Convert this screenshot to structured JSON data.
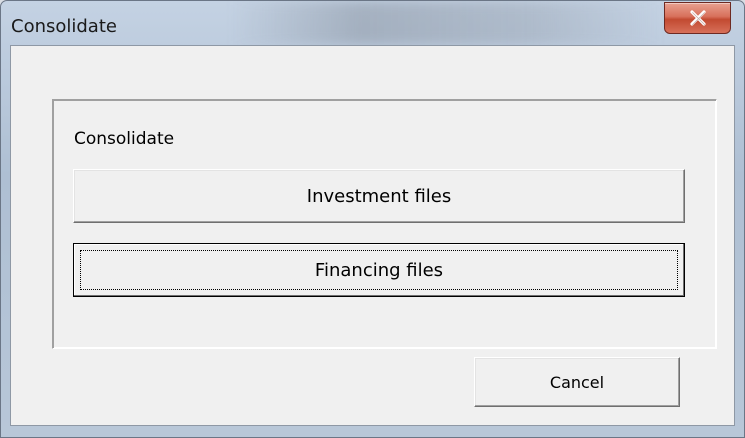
{
  "window": {
    "title": "Consolidate",
    "close_icon": "close-x-icon"
  },
  "frame": {
    "label": "Consolidate"
  },
  "buttons": {
    "investment_label": "Investment files",
    "financing_label": "Financing files",
    "cancel_label": "Cancel"
  },
  "colors": {
    "close_button": "#c94f37",
    "dialog_background": "#f0f0f0",
    "titlebar": "#b8c7d8"
  }
}
